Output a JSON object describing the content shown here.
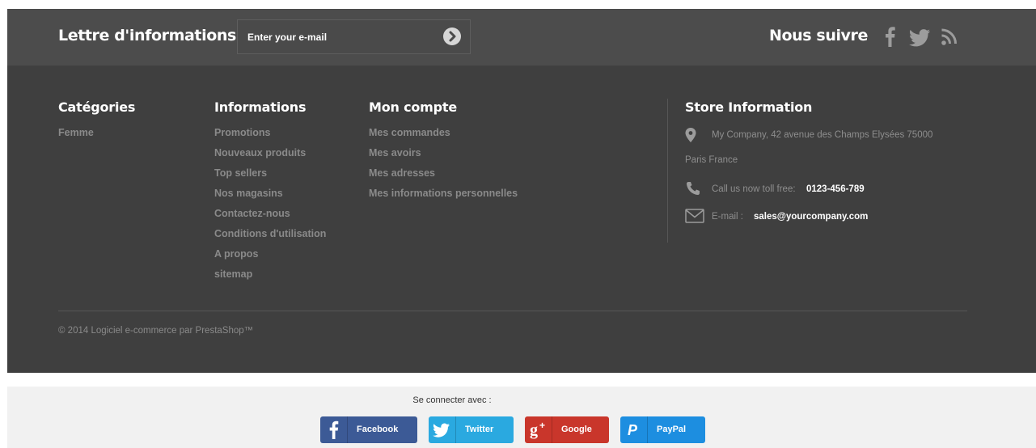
{
  "newsletter": {
    "title": "Lettre d'informations",
    "placeholder": "Enter your e-mail"
  },
  "follow": {
    "title": "Nous suivre",
    "icons": [
      "facebook-icon",
      "twitter-icon",
      "rss-icon"
    ]
  },
  "columns": [
    {
      "title": "Catégories",
      "items": [
        "Femme"
      ]
    },
    {
      "title": "Informations",
      "items": [
        "Promotions",
        "Nouveaux produits",
        "Top sellers",
        "Nos magasins",
        "Contactez-nous",
        "Conditions d'utilisation",
        "A propos",
        "sitemap"
      ]
    },
    {
      "title": "Mon compte",
      "items": [
        "Mes commandes",
        "Mes avoirs",
        "Mes adresses",
        "Mes informations personnelles"
      ]
    }
  ],
  "store": {
    "title": "Store Information",
    "address_line1": "My Company, 42 avenue des Champs Elysées 75000",
    "address_line2": "Paris France",
    "phone_label": "Call us now toll free:",
    "phone": "0123-456-789",
    "email_label": "E-mail :",
    "email": "sales@yourcompany.com"
  },
  "copyright": "© 2014 Logiciel e-commerce par PrestaShop™",
  "connect": {
    "title": "Se connecter avec :",
    "buttons": [
      {
        "label": "Facebook",
        "color": "#3c5a96",
        "icon": "facebook-icon"
      },
      {
        "label": "Twitter",
        "color": "#2aa9e0",
        "icon": "twitter-icon"
      },
      {
        "label": "Google",
        "color": "#c9362b",
        "icon": "google-plus-icon"
      },
      {
        "label": "PayPal",
        "color": "#1d8ee0",
        "icon": "paypal-icon"
      }
    ]
  },
  "colors": {
    "footer_bg": "#3f3f3f",
    "newsletter_bg": "#4c4c4c",
    "link_gray": "#8a8a8a"
  }
}
